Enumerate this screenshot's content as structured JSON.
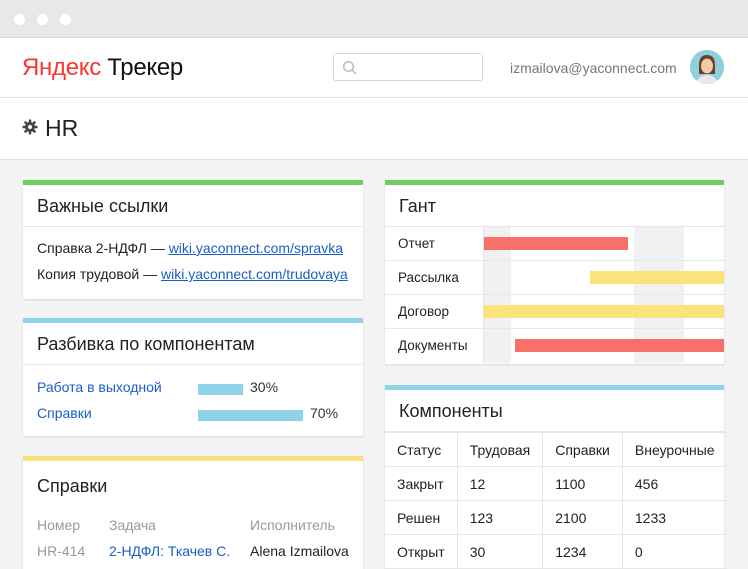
{
  "app": {
    "logo_brand": "Яндекс",
    "logo_product": " Трекер"
  },
  "header": {
    "user_email": "izmailova@yaconnect.com",
    "search_placeholder": ""
  },
  "page": {
    "title": "HR"
  },
  "important_links": {
    "title": "Важные ссылки",
    "items": [
      {
        "prefix": "Справка 2-НДФЛ — ",
        "link": "wiki.yaconnect.com/spravka"
      },
      {
        "prefix": "Копия трудовой — ",
        "link": "wiki.yaconnect.com/trudovaya"
      }
    ]
  },
  "components_breakdown": {
    "title": "Разбивка по компонентам",
    "items": [
      {
        "name": "Работа в выходной",
        "percent": 30,
        "label": "30%"
      },
      {
        "name": "Справки",
        "percent": 70,
        "label": "70%"
      }
    ]
  },
  "certificates": {
    "title": "Справки",
    "headers": [
      "Номер",
      "Задача",
      "Исполнитель"
    ],
    "rows": [
      {
        "number": "HR-414",
        "task": "2-НДФЛ: Ткачев С.",
        "assignee": "Alena Izmailova"
      }
    ]
  },
  "gantt": {
    "title": "Гант",
    "rows": [
      {
        "label": "Отчет",
        "start": 0.0,
        "end": 0.6,
        "color": "#f87168"
      },
      {
        "label": "Рассылка",
        "start": 0.44,
        "end": 1.0,
        "color": "#fbe37b"
      },
      {
        "label": "Договор",
        "start": 0.0,
        "end": 1.0,
        "color": "#fbe37b"
      },
      {
        "label": "Документы",
        "start": 0.13,
        "end": 1.0,
        "color": "#f87168"
      }
    ]
  },
  "components_table": {
    "title": "Компоненты",
    "headers": [
      "Статус",
      "Трудовая",
      "Справки",
      "Внеурочные"
    ],
    "rows": [
      [
        "Закрыт",
        "12",
        "1100",
        "456"
      ],
      [
        "Решен",
        "123",
        "2100",
        "1233"
      ],
      [
        "Открыт",
        "30",
        "1234",
        "0"
      ]
    ]
  },
  "colors": {
    "green": "#6ccf5e",
    "blue": "#8fd3e8",
    "yellow": "#f7e27e",
    "link": "#1a5fc4",
    "logo_red": "#ff3333"
  }
}
